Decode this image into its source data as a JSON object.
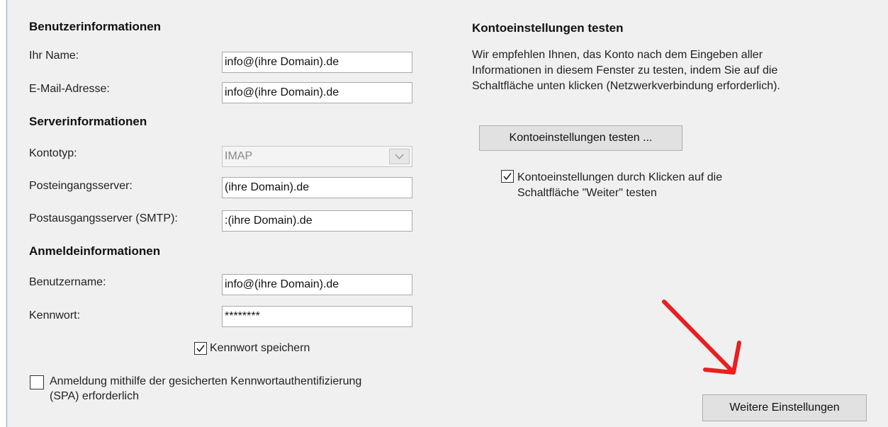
{
  "user_info": {
    "heading": "Benutzerinformationen",
    "name_label": "Ihr Name:",
    "name_value": "info@(ihre Domain).de",
    "email_label": "E-Mail-Adresse:",
    "email_value": "info@(ihre Domain).de"
  },
  "server_info": {
    "heading": "Serverinformationen",
    "account_type_label": "Kontotyp:",
    "account_type_value": "IMAP",
    "incoming_label": "Posteingangsserver:",
    "incoming_value": "(ihre Domain).de",
    "outgoing_label": "Postausgangsserver (SMTP):",
    "outgoing_value": ":(ihre Domain).de"
  },
  "login_info": {
    "heading": "Anmeldeinformationen",
    "username_label": "Benutzername:",
    "username_value": "info@(ihre Domain).de",
    "password_label": "Kennwort:",
    "password_value": "********",
    "save_password_label": "Kennwort speichern",
    "save_password_checked": true,
    "spa_label_line1": "Anmeldung mithilfe der gesicherten Kennwortauthentifizierung",
    "spa_label_line2": "(SPA) erforderlich",
    "spa_checked": false
  },
  "test_settings": {
    "heading": "Kontoeinstellungen testen",
    "description_line1": "Wir empfehlen Ihnen, das Konto nach dem Eingeben aller",
    "description_line2": "Informationen in diesem Fenster zu testen, indem Sie auf die",
    "description_line3": "Schaltfläche unten klicken (Netzwerkverbindung erforderlich).",
    "test_button_label": "Kontoeinstellungen testen ...",
    "auto_test_label_line1": "Kontoeinstellungen durch Klicken auf die",
    "auto_test_label_line2": "Schaltfläche \"Weiter\" testen",
    "auto_test_checked": true
  },
  "more_settings_button_label": "Weitere Einstellungen",
  "annotation_arrow_color": "#e8201f",
  "icons": [
    "checkmark-icon",
    "chevron-down-icon",
    "red-arrow-icon"
  ]
}
